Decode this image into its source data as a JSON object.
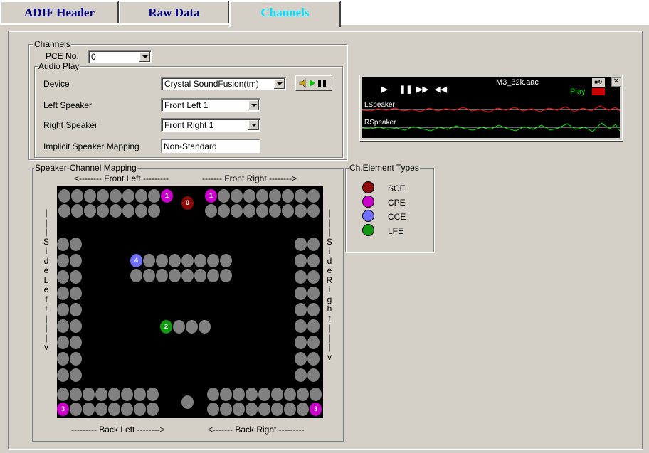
{
  "tabs": [
    "ADIF Header",
    "Raw Data",
    "Channels"
  ],
  "channels": {
    "group_label": "Channels",
    "pce_label": "PCE No.",
    "pce_value": "0"
  },
  "audio_play": {
    "group_label": "Audio Play",
    "device_label": "Device",
    "device_value": "Crystal SoundFusion(tm)",
    "left_speaker_label": "Left Speaker",
    "left_speaker_value": "Front Left 1",
    "right_speaker_label": "Right Speaker",
    "right_speaker_value": "Front Right 1",
    "implicit_label": "Implicit Speaker Mapping",
    "implicit_value": "Non-Standard",
    "play_pause_icon": "speaker-play-pause-icon"
  },
  "player": {
    "filename": "M3_32k.aac",
    "status": "Play",
    "left_channel": "LSpeaker",
    "right_channel": "RSpeaker"
  },
  "mapping": {
    "group_label": "Speaker-Channel Mapping",
    "front_left": "<-------- Front Left ---------",
    "front_right": "------- Front Right -------->",
    "back_left": "--------- Back Left -------->",
    "back_right": "<------- Back Right ---------",
    "side_left": "|||SideLeft|||v",
    "side_right": "|||SideRight|||v",
    "channel_labels": [
      "0",
      "1",
      "1",
      "2",
      "3",
      "3",
      "4"
    ]
  },
  "element_types": {
    "group_label": "Ch.Element Types",
    "items": [
      {
        "label": "SCE",
        "color": "#8b0a0a"
      },
      {
        "label": "CPE",
        "color": "#cc00cc"
      },
      {
        "label": "CCE",
        "color": "#7070ff"
      },
      {
        "label": "LFE",
        "color": "#119911"
      }
    ]
  }
}
